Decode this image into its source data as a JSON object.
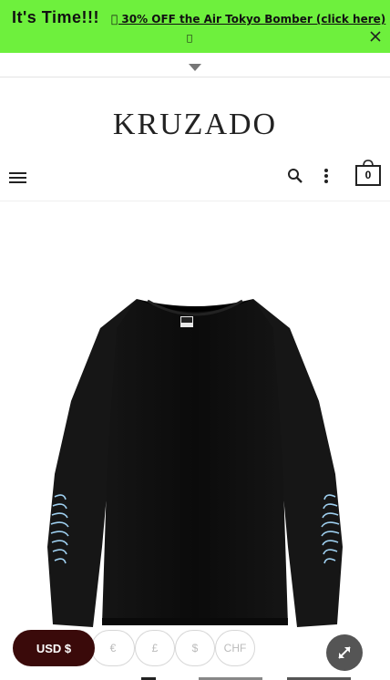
{
  "promo": {
    "title": "It's Time!!!",
    "link_text": "\u0000 30% OFF the Air Tokyo Bomber (click here)",
    "link_glyph": "\u0000",
    "bg_color": "#6ef03d"
  },
  "header": {
    "logo": "KRUZADO",
    "cart_count": "0"
  },
  "currency": {
    "active": "USD $",
    "options": [
      "€",
      "£",
      "$",
      "CHF"
    ]
  },
  "icons": {
    "close": "close-icon",
    "toggle": "caret-down-icon",
    "menu": "hamburger-menu-icon",
    "search": "search-icon",
    "more": "vertical-dots-icon",
    "cart": "shopping-bag-icon",
    "zoom": "expand-icon"
  },
  "colors": {
    "accent": "#6ef03d",
    "currency_active": "#3a0a0a"
  }
}
